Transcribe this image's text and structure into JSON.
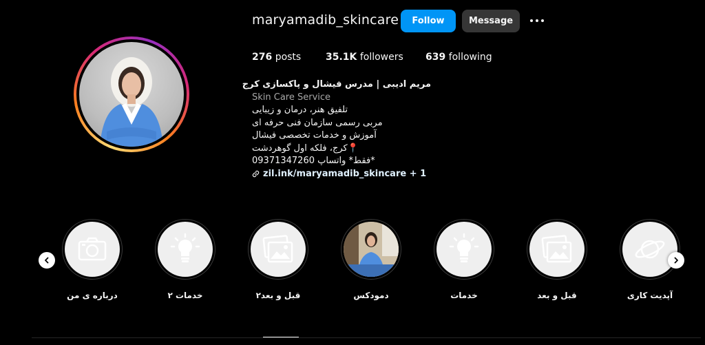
{
  "profile": {
    "username": "maryamadib_skincare",
    "follow_label": "Follow",
    "message_label": "Message",
    "more_icon": "more-horizontal-icon",
    "stats": {
      "posts_count": "276",
      "posts_label": "posts",
      "followers_count": "35.1K",
      "followers_label": "followers",
      "following_count": "639",
      "following_label": "following"
    }
  },
  "bio": {
    "name": "مریم ادیبی | مدرس فیشال و پاکسازی کرج",
    "category": "Skin Care Service",
    "lines": [
      "تلفیق هنر، درمان و زیبایی",
      "مربی رسمی سازمان فنی حرفه ای",
      "آموزش و خدمات تخصصی فیشال",
      "📍کرج، فلکه اول گوهردشت",
      "*فقط* واتساپ 09371347260"
    ],
    "link_text": "zil.ink/maryamadib_skincare + 1"
  },
  "highlights": [
    {
      "label": "درباره ی من",
      "icon": "camera-icon"
    },
    {
      "label": "خدمات ۲",
      "icon": "lightbulb-icon"
    },
    {
      "label": "قبل و بعد۲",
      "icon": "image-gallery-icon"
    },
    {
      "label": "دمودکس",
      "icon": "photo-thumbnail"
    },
    {
      "label": "خدمات",
      "icon": "lightbulb-icon"
    },
    {
      "label": "قبل و بعد",
      "icon": "image-gallery-icon"
    },
    {
      "label": "آپدیت کاری",
      "icon": "planet-icon"
    }
  ],
  "colors": {
    "background": "#000000",
    "follow_button": "#0095f6",
    "message_button": "#363636",
    "highlight_fill": "#efefef",
    "muted_text": "#a8a8a8"
  }
}
